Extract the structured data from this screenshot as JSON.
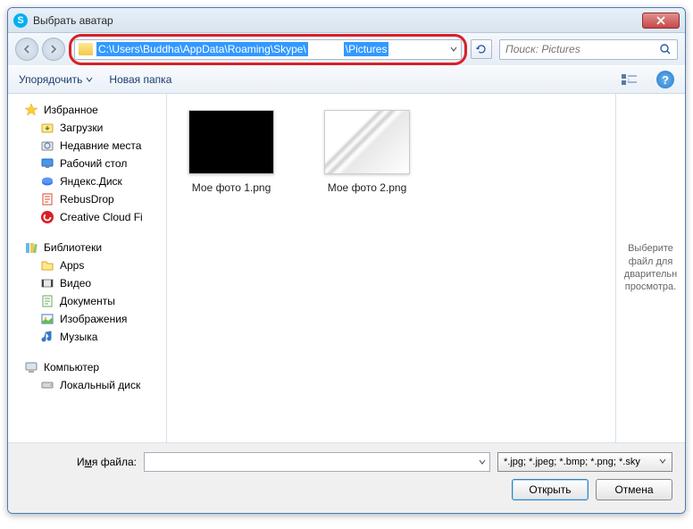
{
  "window": {
    "title": "Выбрать аватар"
  },
  "address": {
    "path1": "C:\\Users\\Buddha\\AppData\\Roaming\\Skype\\",
    "path2": "\\Pictures"
  },
  "search": {
    "placeholder": "Поиск: Pictures"
  },
  "toolbar": {
    "organize": "Упорядочить",
    "newfolder": "Новая папка"
  },
  "sidebar": {
    "favorites": {
      "label": "Избранное",
      "items": [
        {
          "label": "Загрузки",
          "icon": "download"
        },
        {
          "label": "Недавние места",
          "icon": "recent"
        },
        {
          "label": "Рабочий стол",
          "icon": "desktop"
        },
        {
          "label": "Яндекс.Диск",
          "icon": "yadisk"
        },
        {
          "label": "RebusDrop",
          "icon": "rebus"
        },
        {
          "label": "Creative Cloud Fi",
          "icon": "cc"
        }
      ]
    },
    "libraries": {
      "label": "Библиотеки",
      "items": [
        {
          "label": "Apps",
          "icon": "folder"
        },
        {
          "label": "Видео",
          "icon": "video"
        },
        {
          "label": "Документы",
          "icon": "docs"
        },
        {
          "label": "Изображения",
          "icon": "images"
        },
        {
          "label": "Музыка",
          "icon": "music"
        }
      ]
    },
    "computer": {
      "label": "Компьютер",
      "items": [
        {
          "label": "Локальный диск",
          "icon": "disk"
        }
      ]
    }
  },
  "files": [
    {
      "name": "Мое фото 1.png",
      "thumb": "black"
    },
    {
      "name": "Мое фото 2.png",
      "thumb": "white"
    }
  ],
  "preview": {
    "text": "Выберите файл для дварительн просмотра."
  },
  "footer": {
    "filename_label_pre": "И",
    "filename_label_u": "м",
    "filename_label_post": "я файла:",
    "filter": "*.jpg; *.jpeg; *.bmp; *.png; *.sky",
    "open": "Открыть",
    "cancel": "Отмена"
  }
}
